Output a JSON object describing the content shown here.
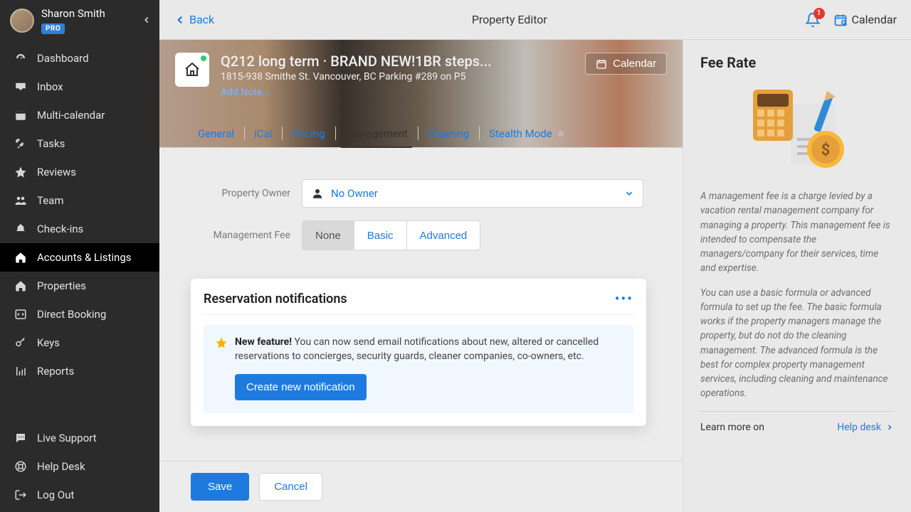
{
  "user": {
    "name": "Sharon Smith",
    "badge": "PRO"
  },
  "sidebar": {
    "items": [
      {
        "label": "Dashboard",
        "icon": "gauge-icon"
      },
      {
        "label": "Inbox",
        "icon": "inbox-icon"
      },
      {
        "label": "Multi-calendar",
        "icon": "calendar-icon"
      },
      {
        "label": "Tasks",
        "icon": "tasks-icon"
      },
      {
        "label": "Reviews",
        "icon": "star-icon"
      },
      {
        "label": "Team",
        "icon": "team-icon"
      },
      {
        "label": "Check-ins",
        "icon": "bell-icon"
      },
      {
        "label": "Accounts & Listings",
        "icon": "home-icon"
      },
      {
        "label": "Properties",
        "icon": "home-icon"
      },
      {
        "label": "Direct Booking",
        "icon": "code-icon"
      },
      {
        "label": "Keys",
        "icon": "key-icon"
      },
      {
        "label": "Reports",
        "icon": "chart-icon"
      }
    ],
    "bottom": [
      {
        "label": "Live Support",
        "icon": "chat-icon"
      },
      {
        "label": "Help Desk",
        "icon": "lifebuoy-icon"
      },
      {
        "label": "Log Out",
        "icon": "logout-icon"
      }
    ],
    "active_index": 7
  },
  "topbar": {
    "back": "Back",
    "title": "Property Editor",
    "calendar": "Calendar",
    "notifications": "1"
  },
  "hero": {
    "title": "Q212 long term · BRAND NEW!1BR steps...",
    "subtitle": "1815-938 Smithe St. Vancouver, BC Parking #289 on P5",
    "add_note": "Add Note...",
    "calendar_btn": "Calendar"
  },
  "tabs": {
    "items": [
      "General",
      "iCal",
      "Pricing",
      "Management",
      "Cleaning",
      "Stealth Mode"
    ],
    "active_index": 3,
    "stealth_dot": true
  },
  "form": {
    "owner_label": "Property Owner",
    "owner_value": "No Owner",
    "fee_label": "Management Fee",
    "fee_options": [
      "None",
      "Basic",
      "Advanced"
    ],
    "fee_active_index": 0
  },
  "card": {
    "title": "Reservation notifications",
    "feature_label": "New feature!",
    "feature_text": " You can now send email notifications about new, altered or cancelled reservations to concierges, security guards, cleaner companies, co-owners, etc.",
    "cta": "Create new notification"
  },
  "actions": {
    "save": "Save",
    "cancel": "Cancel"
  },
  "right": {
    "title": "Fee Rate",
    "p1": "A management fee is a charge levied by a vacation rental management company for managing a property. This management fee is intended to compensate the managers/company for their services, time and expertise.",
    "p2": "You can use a basic formula or advanced formula to set up the fee. The basic formula works if the property managers manage the property, but do not do the cleaning management. The advanced formula is the best for complex property management services, including cleaning and maintenance operations.",
    "learn_more": "Learn more on",
    "help_desk": "Help desk"
  }
}
